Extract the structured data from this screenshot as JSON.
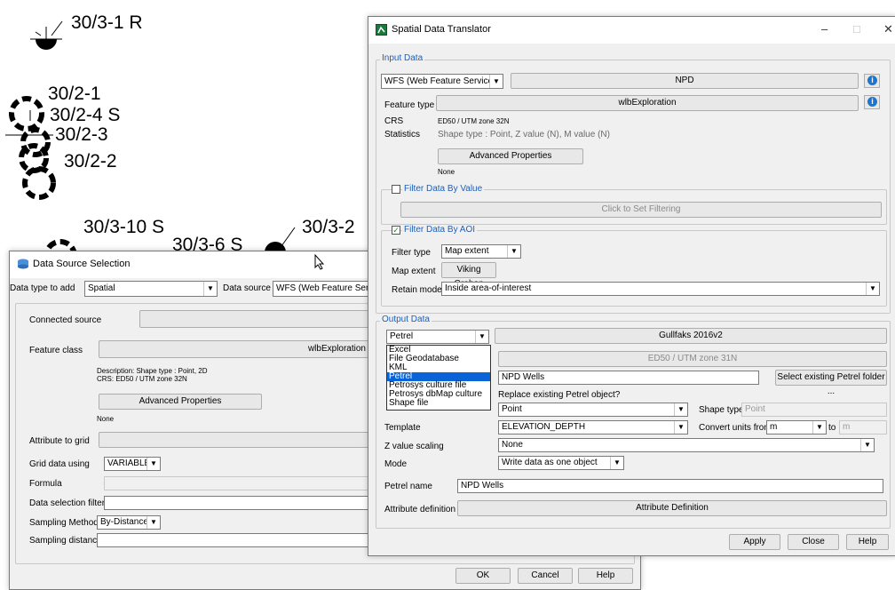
{
  "map": {
    "wells": [
      "30/3-1 R",
      "30/2-1",
      "30/2-4 S",
      "30/2-3",
      "30/2-2",
      "30/3-10 S",
      "30/3-6 S",
      "30/3-2"
    ]
  },
  "ds": {
    "title": "Data Source Selection",
    "type_label": "Data type to add",
    "type_value": "Spatial",
    "source_label": "Data source",
    "source_value": "WFS (Web Feature Service)",
    "connected_label": "Connected source",
    "feature_label": "Feature class",
    "feature_value": "wlbExploration",
    "description": "Description: Shape type : Point, 2D",
    "crs": "CRS:     ED50 / UTM zone 32N",
    "adv_button": "Advanced Properties",
    "none": "None",
    "attr_label": "Attribute to grid",
    "grid_label": "Grid data using",
    "grid_value": "VARIABLE",
    "formula_label": "Formula",
    "filter_label": "Data selection filter",
    "sampling_label": "Sampling Method",
    "sampling_value": "By-Distance",
    "sdist_label": "Sampling distance",
    "ok": "OK",
    "cancel": "Cancel",
    "help": "Help"
  },
  "sdt": {
    "title": "Spatial Data Translator",
    "input_group": "Input Data",
    "service_value": "WFS (Web Feature Service)",
    "npd_button": "NPD",
    "ftype_label": "Feature type",
    "ftype_value": "wlbExploration",
    "crs_label": "CRS",
    "crs_value": "ED50 / UTM zone 32N",
    "stats_label": "Statistics",
    "stats_value": "Shape type : Point, Z value (N), M value (N)",
    "adv_button": "Advanced Properties",
    "none": "None",
    "filter_value_group": "Filter Data By Value",
    "click_filter": "Click to Set Filtering",
    "filter_aoi_group": "Filter Data By AOI",
    "filter_type_label": "Filter type",
    "filter_type_value": "Map extent",
    "map_extent_label": "Map extent",
    "map_extent_value": "Viking Graben",
    "retain_label": "Retain mode",
    "retain_value": "Inside area-of-interest",
    "output_group": "Output Data",
    "output_value": "Petrel",
    "gullfaks_button": "Gullfaks 2016v2",
    "crs_out_button": "ED50 / UTM zone 31N",
    "name_field": "NPD Wells",
    "select_folder_button": "Select existing Petrel folder ...",
    "replace_label": "Replace existing Petrel object?",
    "point_value": "Point",
    "shape_type_label": "Shape type",
    "shape_type_value": "Point",
    "template_label": "Template",
    "template_value": "ELEVATION_DEPTH",
    "convert_label": "Convert units from",
    "convert_from": "m",
    "to_label": "to",
    "convert_to": "m",
    "zscale_label": "Z value scaling",
    "zscale_value": "None",
    "mode_label": "Mode",
    "mode_value": "Write data as one object",
    "petrel_name_label": "Petrel name",
    "petrel_name_value": "NPD Wells",
    "attrdef_label": "Attribute definition",
    "attrdef_button": "Attribute Definition",
    "apply": "Apply",
    "close": "Close",
    "help": "Help",
    "dropdown_options": [
      "Excel",
      "File Geodatabase",
      "KML",
      "Petrel",
      "Petrosys culture file",
      "Petrosys dbMap culture",
      "Shape file"
    ],
    "dropdown_selected": "Petrel"
  },
  "colors": {
    "accent": "#1f5fb5",
    "selection": "#0a64d8"
  }
}
